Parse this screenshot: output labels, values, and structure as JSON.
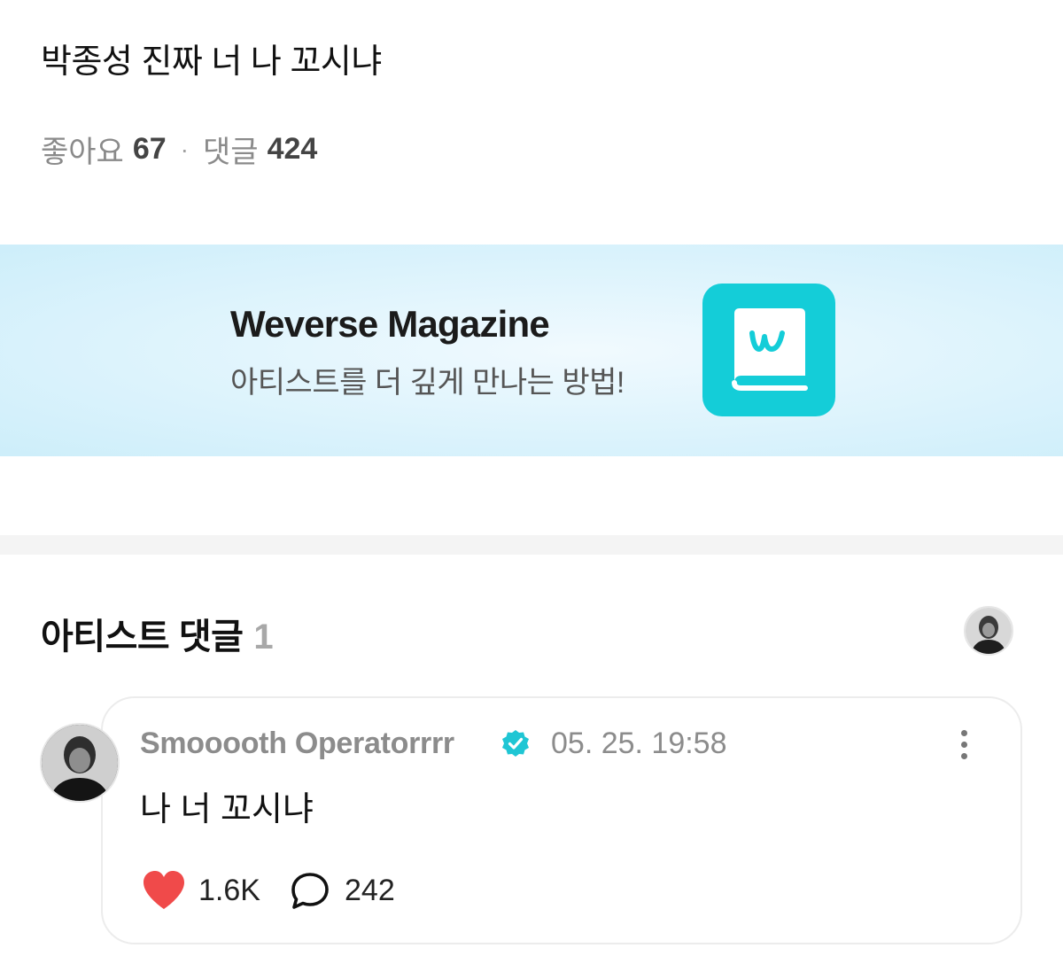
{
  "post": {
    "text": "박종성 진짜 너 나 꼬시냐",
    "likes_label": "좋아요",
    "likes_count": "67",
    "separator": "·",
    "comments_label": "댓글",
    "comments_count": "424"
  },
  "banner": {
    "title": "Weverse Magazine",
    "subtitle": "아티스트를 더 깊게 만나는 방법!",
    "icon": "weverse-magazine-book-icon",
    "accent_color": "#14cdd8"
  },
  "artist_comments": {
    "title": "아티스트 댓글",
    "count": "1",
    "comment": {
      "author": "Smooooth Operatorrrr",
      "verified": true,
      "timestamp": "05. 25. 19:58",
      "body": "나 너 꼬시냐",
      "like_count": "1.6K",
      "reply_count": "242",
      "like_color": "#f04a4a",
      "verified_color": "#1fc6d4"
    }
  }
}
